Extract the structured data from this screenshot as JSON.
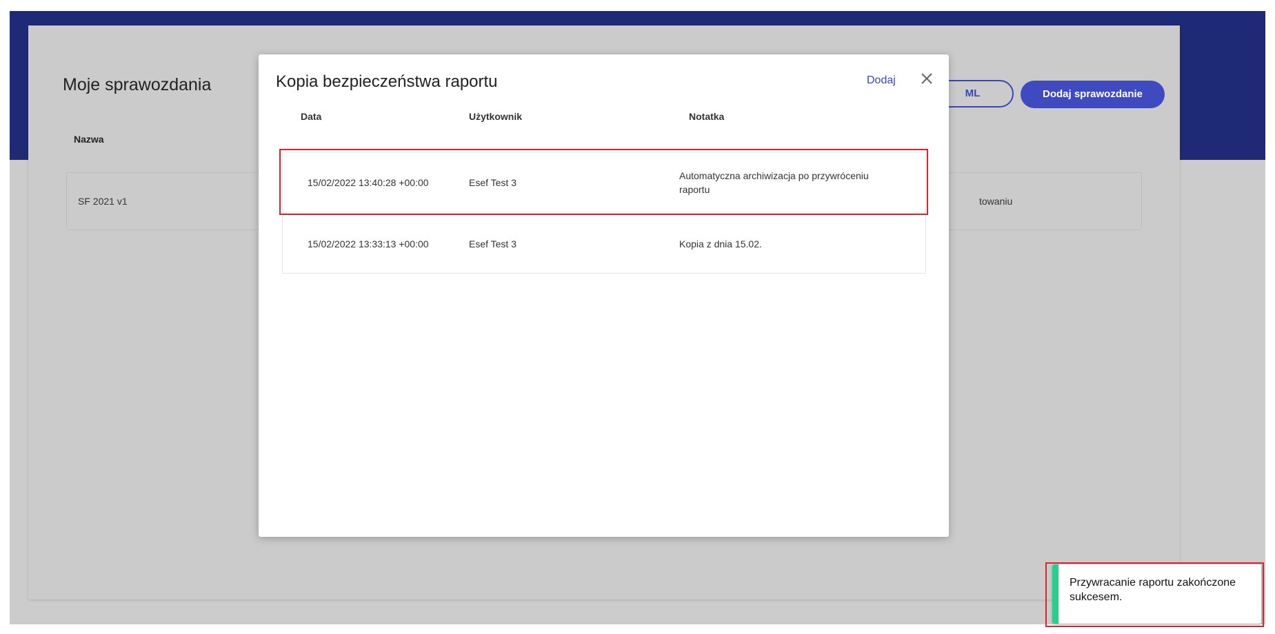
{
  "background": {
    "page_title": "Moje sprawozdania",
    "column_name": "Nazwa",
    "report_name": "SF 2021 v1",
    "report_status_partial": "towaniu",
    "xml_button_partial": "ML",
    "add_report_button": "Dodaj sprawozdanie"
  },
  "modal": {
    "title": "Kopia bezpieczeństwa raportu",
    "add_label": "Dodaj",
    "close_icon": "close-icon",
    "columns": {
      "date": "Data",
      "user": "Użytkownik",
      "note": "Notatka"
    },
    "rows": [
      {
        "date": "15/02/2022 13:40:28 +00:00",
        "user": "Esef Test 3",
        "note": "Automatyczna archiwizacja po przywróceniu raportu"
      },
      {
        "date": "15/02/2022 13:33:13 +00:00",
        "user": "Esef Test 3",
        "note": "Kopia z dnia 15.02."
      }
    ]
  },
  "toast": {
    "message": "Przywracanie raportu zakończone sukcesem."
  },
  "colors": {
    "banner": "#1f2a76",
    "accent": "#3f4ac1",
    "highlight": "#d9232d",
    "success": "#2ecc8a"
  }
}
